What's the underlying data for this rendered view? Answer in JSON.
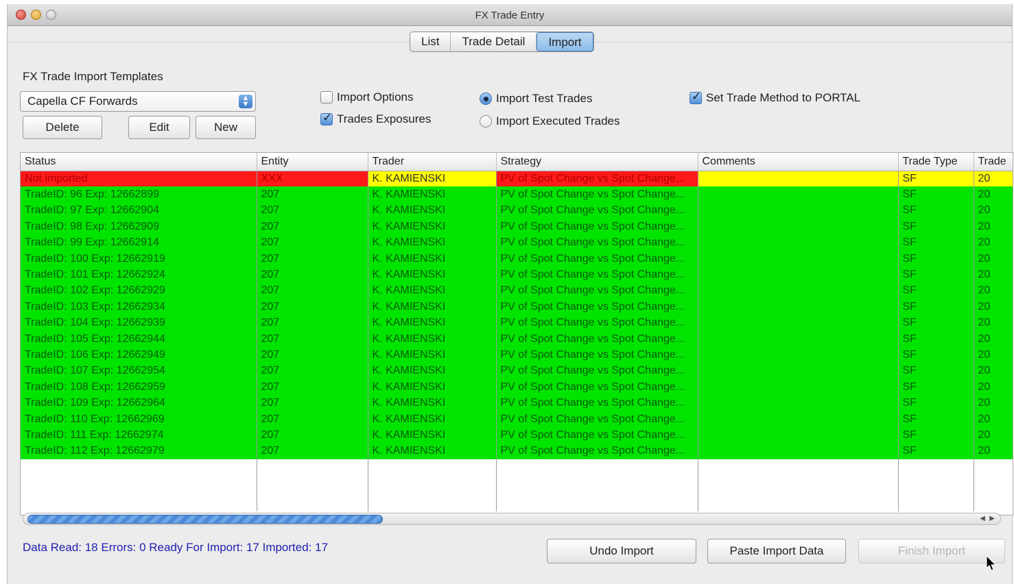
{
  "window": {
    "title": "FX Trade Entry"
  },
  "tabs": [
    {
      "label": "List",
      "active": false
    },
    {
      "label": "Trade Detail",
      "active": false
    },
    {
      "label": "Import",
      "active": true
    }
  ],
  "templates": {
    "label": "FX Trade Import Templates",
    "selected": "Capella CF Forwards",
    "delete_label": "Delete",
    "edit_label": "Edit",
    "new_label": "New"
  },
  "options": {
    "import_options": {
      "label": "Import Options",
      "checked": false
    },
    "trades_exposures": {
      "label": "Trades  Exposures",
      "checked": true
    },
    "import_test_trades": {
      "label": "Import Test Trades",
      "selected": true
    },
    "import_executed_trades": {
      "label": "Import Executed Trades",
      "selected": false
    },
    "set_trade_method": {
      "label": "Set Trade Method to PORTAL",
      "checked": true
    }
  },
  "table": {
    "columns": [
      "Status",
      "Entity",
      "Trader",
      "Strategy",
      "Comments",
      "Trade Type",
      "Trade"
    ],
    "rows": [
      {
        "state": "error",
        "cells": [
          "Not imported",
          "XXX",
          "K. KAMIENSKI",
          "PV of Spot Change vs Spot Change...",
          "",
          "SF",
          "20"
        ]
      },
      {
        "state": "ok",
        "cells": [
          "TradeID:  96 Exp: 12662899",
          "207",
          "K. KAMIENSKI",
          "PV of Spot Change vs Spot Change...",
          "",
          "SF",
          "20"
        ]
      },
      {
        "state": "ok",
        "cells": [
          "TradeID:  97 Exp: 12662904",
          "207",
          "K. KAMIENSKI",
          "PV of Spot Change vs Spot Change...",
          "",
          "SF",
          "20"
        ]
      },
      {
        "state": "ok",
        "cells": [
          "TradeID:  98 Exp: 12662909",
          "207",
          "K. KAMIENSKI",
          "PV of Spot Change vs Spot Change...",
          "",
          "SF",
          "20"
        ]
      },
      {
        "state": "ok",
        "cells": [
          "TradeID:  99 Exp: 12662914",
          "207",
          "K. KAMIENSKI",
          "PV of Spot Change vs Spot Change...",
          "",
          "SF",
          "20"
        ]
      },
      {
        "state": "ok",
        "cells": [
          "TradeID:  100 Exp: 12662919",
          "207",
          "K. KAMIENSKI",
          "PV of Spot Change vs Spot Change...",
          "",
          "SF",
          "20"
        ]
      },
      {
        "state": "ok",
        "cells": [
          "TradeID:  101 Exp: 12662924",
          "207",
          "K. KAMIENSKI",
          "PV of Spot Change vs Spot Change...",
          "",
          "SF",
          "20"
        ]
      },
      {
        "state": "ok",
        "cells": [
          "TradeID:  102 Exp: 12662929",
          "207",
          "K. KAMIENSKI",
          "PV of Spot Change vs Spot Change...",
          "",
          "SF",
          "20"
        ]
      },
      {
        "state": "ok",
        "cells": [
          "TradeID:  103 Exp: 12662934",
          "207",
          "K. KAMIENSKI",
          "PV of Spot Change vs Spot Change...",
          "",
          "SF",
          "20"
        ]
      },
      {
        "state": "ok",
        "cells": [
          "TradeID:  104 Exp: 12662939",
          "207",
          "K. KAMIENSKI",
          "PV of Spot Change vs Spot Change...",
          "",
          "SF",
          "20"
        ]
      },
      {
        "state": "ok",
        "cells": [
          "TradeID:  105 Exp: 12662944",
          "207",
          "K. KAMIENSKI",
          "PV of Spot Change vs Spot Change...",
          "",
          "SF",
          "20"
        ]
      },
      {
        "state": "ok",
        "cells": [
          "TradeID:  106 Exp: 12662949",
          "207",
          "K. KAMIENSKI",
          "PV of Spot Change vs Spot Change...",
          "",
          "SF",
          "20"
        ]
      },
      {
        "state": "ok",
        "cells": [
          "TradeID:  107 Exp: 12662954",
          "207",
          "K. KAMIENSKI",
          "PV of Spot Change vs Spot Change...",
          "",
          "SF",
          "20"
        ]
      },
      {
        "state": "ok",
        "cells": [
          "TradeID:  108 Exp: 12662959",
          "207",
          "K. KAMIENSKI",
          "PV of Spot Change vs Spot Change...",
          "",
          "SF",
          "20"
        ]
      },
      {
        "state": "ok",
        "cells": [
          "TradeID:  109 Exp: 12662964",
          "207",
          "K. KAMIENSKI",
          "PV of Spot Change vs Spot Change...",
          "",
          "SF",
          "20"
        ]
      },
      {
        "state": "ok",
        "cells": [
          "TradeID:  110 Exp: 12662969",
          "207",
          "K. KAMIENSKI",
          "PV of Spot Change vs Spot Change...",
          "",
          "SF",
          "20"
        ]
      },
      {
        "state": "ok",
        "cells": [
          "TradeID:  111 Exp: 12662974",
          "207",
          "K. KAMIENSKI",
          "PV of Spot Change vs Spot Change...",
          "",
          "SF",
          "20"
        ]
      },
      {
        "state": "ok",
        "cells": [
          "TradeID:  112 Exp: 12662979",
          "207",
          "K. KAMIENSKI",
          "PV of Spot Change vs Spot Change...",
          "",
          "SF",
          "20"
        ]
      }
    ]
  },
  "status_bar": {
    "text": "Data Read: 18  Errors: 0  Ready For Import: 17 Imported: 17"
  },
  "actions": {
    "undo_label": "Undo Import",
    "paste_label": "Paste Import Data",
    "finish_label": "Finish Import"
  },
  "colors": {
    "ok_row": "#00e400",
    "error_row": "#ffff00",
    "error_cell": "#ff1a1a",
    "status_text": "#2020b0"
  }
}
